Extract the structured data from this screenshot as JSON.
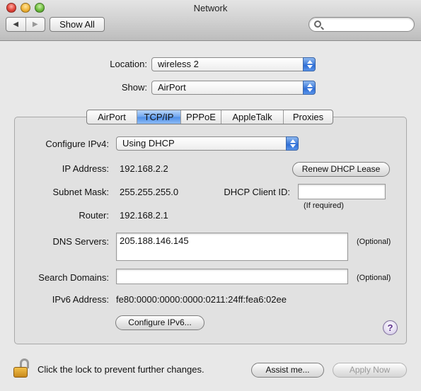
{
  "window": {
    "title": "Network"
  },
  "toolbar": {
    "back_icon": "back-arrow-icon",
    "forward_icon": "forward-arrow-icon",
    "show_all_label": "Show All",
    "search_icon": "search-icon",
    "search_value": ""
  },
  "location": {
    "label": "Location:",
    "value": "wireless 2"
  },
  "show": {
    "label": "Show:",
    "value": "AirPort"
  },
  "tabs": [
    {
      "label": "AirPort",
      "active": false
    },
    {
      "label": "TCP/IP",
      "active": true
    },
    {
      "label": "PPPoE",
      "active": false
    },
    {
      "label": "AppleTalk",
      "active": false
    },
    {
      "label": "Proxies",
      "active": false
    }
  ],
  "tcpip": {
    "configure_label": "Configure IPv4:",
    "configure_value": "Using DHCP",
    "ip_label": "IP Address:",
    "ip_value": "192.168.2.2",
    "renew_button": "Renew DHCP Lease",
    "subnet_label": "Subnet Mask:",
    "subnet_value": "255.255.255.0",
    "client_id_label": "DHCP Client ID:",
    "client_id_value": "",
    "if_required": "(If required)",
    "router_label": "Router:",
    "router_value": "192.168.2.1",
    "dns_label": "DNS Servers:",
    "dns_value": "205.188.146.145",
    "dns_optional": "(Optional)",
    "search_domains_label": "Search Domains:",
    "search_domains_value": "",
    "search_domains_optional": "(Optional)",
    "ipv6_label": "IPv6 Address:",
    "ipv6_value": "fe80:0000:0000:0000:0211:24ff:fea6:02ee",
    "configure_ipv6_button": "Configure IPv6...",
    "help_label": "?"
  },
  "footer": {
    "lock_icon": "lock-icon",
    "lock_text": "Click the lock to prevent further changes.",
    "assist_button": "Assist me...",
    "apply_button": "Apply Now"
  },
  "colors": {
    "accent": "#4f8fe8",
    "window_bg": "#e8e8e8",
    "group_bg": "#e1e1e1",
    "disabled_text": "#9a9a9a"
  }
}
